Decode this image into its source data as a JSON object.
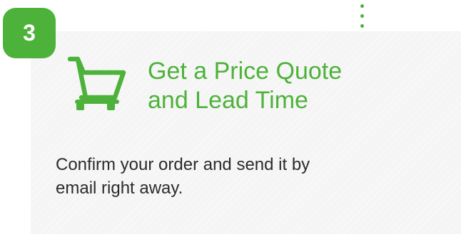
{
  "step": {
    "number": "3",
    "badge_color": "#4db23a"
  },
  "card": {
    "icon": "shopping-cart-icon",
    "title_lines": [
      "Get a Price Quote",
      "and Lead Time"
    ],
    "title_color": "#4db23a",
    "description_lines": [
      "Confirm your order and send it by",
      "email right away."
    ],
    "description_color": "#2b2b2b",
    "background_color": "#f5f5f5"
  }
}
